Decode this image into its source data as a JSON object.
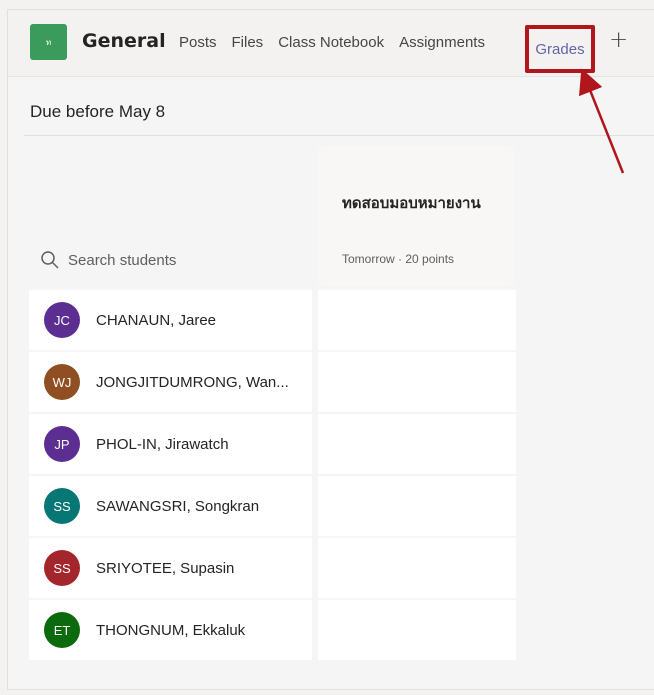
{
  "header": {
    "team_initial": "ท",
    "team_name": "General",
    "tabs": [
      "Posts",
      "Files",
      "Class Notebook",
      "Assignments"
    ],
    "active_tab": "Grades",
    "add_tab_symbol": "+"
  },
  "section": {
    "due_label": "Due before May 8"
  },
  "search": {
    "placeholder": "Search students"
  },
  "assignment": {
    "title": "ทดสอบมอบหมายงาน",
    "meta": "Tomorrow · 20 points"
  },
  "students": [
    {
      "initials": "JC",
      "name": "CHANAUN, Jaree",
      "color": "#5c2e91"
    },
    {
      "initials": "WJ",
      "name": "JONGJITDUMRONG, Wan...",
      "color": "#8f4f23"
    },
    {
      "initials": "JP",
      "name": "PHOL-IN, Jirawatch",
      "color": "#5c2e91"
    },
    {
      "initials": "SS",
      "name": "SAWANGSRI, Songkran",
      "color": "#077775"
    },
    {
      "initials": "SS",
      "name": "SRIYOTEE, Supasin",
      "color": "#a4262c"
    },
    {
      "initials": "ET",
      "name": "THONGNUM, Ekkaluk",
      "color": "#0b6a0b"
    }
  ],
  "colors": {
    "accent": "#6264a7",
    "highlight": "#b0161c"
  }
}
